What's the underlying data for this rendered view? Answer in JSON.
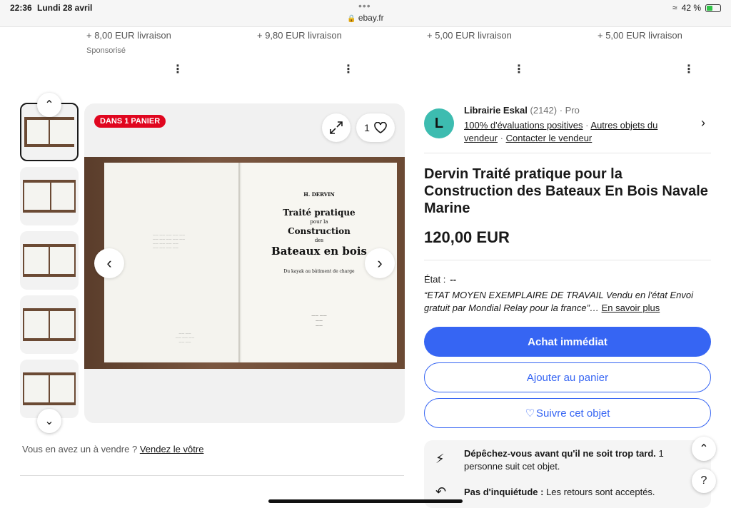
{
  "status": {
    "time": "22:36",
    "date": "Lundi 28 avril",
    "url": "ebay.fr",
    "battery": "42 %",
    "battery_level": 0.42
  },
  "strip": {
    "shipping": [
      "+ 8,00 EUR livraison",
      "+ 9,80 EUR livraison",
      "+ 5,00 EUR livraison",
      "+ 5,00 EUR livraison"
    ],
    "sponsored": "Sponsorisé"
  },
  "gallery": {
    "badge": "DANS 1 PANIER",
    "watch_count": "1",
    "book": {
      "author": "H. DERVIN",
      "line1": "Traité pratique",
      "pour_la": "pour la",
      "line2": "Construction",
      "des": "des",
      "line3": "Bateaux en bois",
      "subtitle": "Du kayak au bâtiment de charge"
    }
  },
  "seller": {
    "initial": "L",
    "name": "Librairie Eskal",
    "count": "(2142)",
    "type": "· Pro",
    "feedback": "100% d'évaluations positives",
    "other_items": "Autres objets du vendeur",
    "contact": "Contacter le vendeur"
  },
  "listing": {
    "title": "Dervin Traité pratique pour la Construction des Bateaux En Bois Navale Marine",
    "price": "120,00 EUR",
    "condition_label": "État :",
    "condition_value": "--",
    "condition_desc": "“ETAT MOYEN EXEMPLAIRE DE TRAVAIL Vendu en l'état Envoi gratuit par Mondial Relay pour la france”…",
    "learn_more": "En savoir plus"
  },
  "actions": {
    "buy_now": "Achat immédiat",
    "add_to_cart": "Ajouter au panier",
    "watch": "Suivre cet objet"
  },
  "info": {
    "hurry_bold": "Dépêchez-vous avant qu'il ne soit trop tard.",
    "hurry_rest": "1 personne suit cet objet.",
    "returns_bold": "Pas d'inquiétude :",
    "returns_rest": "Les retours sont acceptés."
  },
  "sell": {
    "question": "Vous en avez un à vendre ?",
    "link": "Vendez le vôtre"
  }
}
